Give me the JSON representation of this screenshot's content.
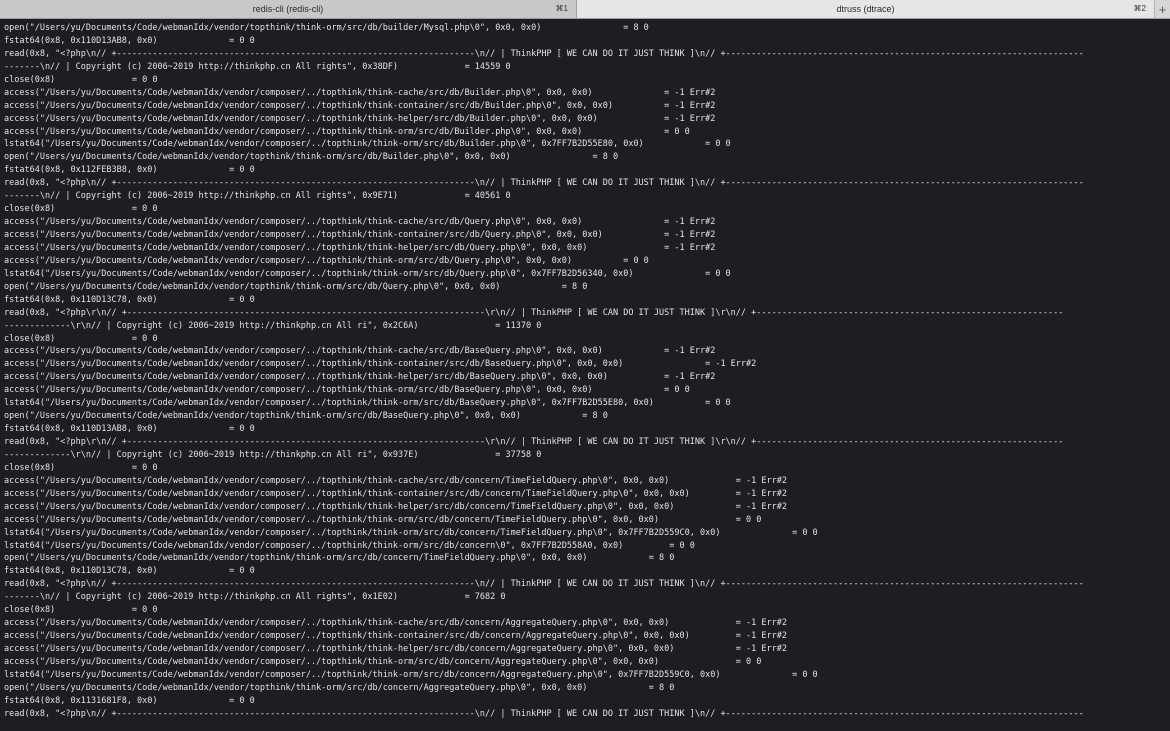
{
  "tabs": [
    {
      "label": "redis-cli (redis-cli)",
      "shortcut": "⌘1",
      "active": false
    },
    {
      "label": "dtruss (dtrace)",
      "shortcut": "⌘2",
      "active": true
    }
  ],
  "new_tab_icon": "+",
  "lines": [
    "open(\"/Users/yu/Documents/Code/webmanIdx/vendor/topthink/think-orm/src/db/builder/Mysql.php\\0\", 0x0, 0x0)                = 8 0",
    "fstat64(0x8, 0x110D13AB8, 0x0)              = 0 0",
    "read(0x8, \"<?php\\n// +----------------------------------------------------------------------\\n// | ThinkPHP [ WE CAN DO IT JUST THINK ]\\n// +----------------------------------------------------------------------",
    "-------\\n// | Copyright (c) 2006~2019 http://thinkphp.cn All rights\", 0x38DF)             = 14559 0",
    "close(0x8)               = 0 0",
    "access(\"/Users/yu/Documents/Code/webmanIdx/vendor/composer/../topthink/think-cache/src/db/Builder.php\\0\", 0x0, 0x0)              = -1 Err#2",
    "access(\"/Users/yu/Documents/Code/webmanIdx/vendor/composer/../topthink/think-container/src/db/Builder.php\\0\", 0x0, 0x0)          = -1 Err#2",
    "access(\"/Users/yu/Documents/Code/webmanIdx/vendor/composer/../topthink/think-helper/src/db/Builder.php\\0\", 0x0, 0x0)             = -1 Err#2",
    "access(\"/Users/yu/Documents/Code/webmanIdx/vendor/composer/../topthink/think-orm/src/db/Builder.php\\0\", 0x0, 0x0)                = 0 0",
    "lstat64(\"/Users/yu/Documents/Code/webmanIdx/vendor/composer/../topthink/think-orm/src/db/Builder.php\\0\", 0x7FF7B2D55E80, 0x0)            = 0 0",
    "open(\"/Users/yu/Documents/Code/webmanIdx/vendor/topthink/think-orm/src/db/Builder.php\\0\", 0x0, 0x0)                = 8 0",
    "fstat64(0x8, 0x112FEB3B8, 0x0)              = 0 0",
    "read(0x8, \"<?php\\n// +----------------------------------------------------------------------\\n// | ThinkPHP [ WE CAN DO IT JUST THINK ]\\n// +----------------------------------------------------------------------",
    "-------\\n// | Copyright (c) 2006~2019 http://thinkphp.cn All rights\", 0x9E71)             = 40561 0",
    "close(0x8)               = 0 0",
    "access(\"/Users/yu/Documents/Code/webmanIdx/vendor/composer/../topthink/think-cache/src/db/Query.php\\0\", 0x0, 0x0)                = -1 Err#2",
    "access(\"/Users/yu/Documents/Code/webmanIdx/vendor/composer/../topthink/think-container/src/db/Query.php\\0\", 0x0, 0x0)            = -1 Err#2",
    "access(\"/Users/yu/Documents/Code/webmanIdx/vendor/composer/../topthink/think-helper/src/db/Query.php\\0\", 0x0, 0x0)               = -1 Err#2",
    "access(\"/Users/yu/Documents/Code/webmanIdx/vendor/composer/../topthink/think-orm/src/db/Query.php\\0\", 0x0, 0x0)          = 0 0",
    "lstat64(\"/Users/yu/Documents/Code/webmanIdx/vendor/composer/../topthink/think-orm/src/db/Query.php\\0\", 0x7FF7B2D56340, 0x0)              = 0 0",
    "open(\"/Users/yu/Documents/Code/webmanIdx/vendor/topthink/think-orm/src/db/Query.php\\0\", 0x0, 0x0)            = 8 0",
    "fstat64(0x8, 0x110D13C78, 0x0)              = 0 0",
    "read(0x8, \"<?php\\r\\n// +----------------------------------------------------------------------\\r\\n// | ThinkPHP [ WE CAN DO IT JUST THINK ]\\r\\n// +------------------------------------------------------------",
    "-------------\\r\\n// | Copyright (c) 2006~2019 http://thinkphp.cn All ri\", 0x2C6A)               = 11370 0",
    "close(0x8)               = 0 0",
    "access(\"/Users/yu/Documents/Code/webmanIdx/vendor/composer/../topthink/think-cache/src/db/BaseQuery.php\\0\", 0x0, 0x0)            = -1 Err#2",
    "access(\"/Users/yu/Documents/Code/webmanIdx/vendor/composer/../topthink/think-container/src/db/BaseQuery.php\\0\", 0x0, 0x0)                = -1 Err#2",
    "access(\"/Users/yu/Documents/Code/webmanIdx/vendor/composer/../topthink/think-helper/src/db/BaseQuery.php\\0\", 0x0, 0x0)           = -1 Err#2",
    "access(\"/Users/yu/Documents/Code/webmanIdx/vendor/composer/../topthink/think-orm/src/db/BaseQuery.php\\0\", 0x0, 0x0)              = 0 0",
    "lstat64(\"/Users/yu/Documents/Code/webmanIdx/vendor/composer/../topthink/think-orm/src/db/BaseQuery.php\\0\", 0x7FF7B2D55E80, 0x0)          = 0 0",
    "open(\"/Users/yu/Documents/Code/webmanIdx/vendor/topthink/think-orm/src/db/BaseQuery.php\\0\", 0x0, 0x0)            = 8 0",
    "fstat64(0x8, 0x110D13AB8, 0x0)              = 0 0",
    "read(0x8, \"<?php\\r\\n// +----------------------------------------------------------------------\\r\\n// | ThinkPHP [ WE CAN DO IT JUST THINK ]\\r\\n// +------------------------------------------------------------",
    "-------------\\r\\n// | Copyright (c) 2006~2019 http://thinkphp.cn All ri\", 0x937E)               = 37758 0",
    "close(0x8)               = 0 0",
    "access(\"/Users/yu/Documents/Code/webmanIdx/vendor/composer/../topthink/think-cache/src/db/concern/TimeFieldQuery.php\\0\", 0x0, 0x0)             = -1 Err#2",
    "access(\"/Users/yu/Documents/Code/webmanIdx/vendor/composer/../topthink/think-container/src/db/concern/TimeFieldQuery.php\\0\", 0x0, 0x0)         = -1 Err#2",
    "access(\"/Users/yu/Documents/Code/webmanIdx/vendor/composer/../topthink/think-helper/src/db/concern/TimeFieldQuery.php\\0\", 0x0, 0x0)            = -1 Err#2",
    "access(\"/Users/yu/Documents/Code/webmanIdx/vendor/composer/../topthink/think-orm/src/db/concern/TimeFieldQuery.php\\0\", 0x0, 0x0)               = 0 0",
    "lstat64(\"/Users/yu/Documents/Code/webmanIdx/vendor/composer/../topthink/think-orm/src/db/concern/TimeFieldQuery.php\\0\", 0x7FF7B2D559C0, 0x0)              = 0 0",
    "lstat64(\"/Users/yu/Documents/Code/webmanIdx/vendor/composer/../topthink/think-orm/src/db/concern\\0\", 0x7FF7B2D558A0, 0x0)         = 0 0",
    "open(\"/Users/yu/Documents/Code/webmanIdx/vendor/topthink/think-orm/src/db/concern/TimeFieldQuery.php\\0\", 0x0, 0x0)            = 8 0",
    "fstat64(0x8, 0x110D13C78, 0x0)              = 0 0",
    "read(0x8, \"<?php\\n// +----------------------------------------------------------------------\\n// | ThinkPHP [ WE CAN DO IT JUST THINK ]\\n// +----------------------------------------------------------------------",
    "-------\\n// | Copyright (c) 2006~2019 http://thinkphp.cn All rights\", 0x1E02)             = 7682 0",
    "close(0x8)               = 0 0",
    "access(\"/Users/yu/Documents/Code/webmanIdx/vendor/composer/../topthink/think-cache/src/db/concern/AggregateQuery.php\\0\", 0x0, 0x0)             = -1 Err#2",
    "access(\"/Users/yu/Documents/Code/webmanIdx/vendor/composer/../topthink/think-container/src/db/concern/AggregateQuery.php\\0\", 0x0, 0x0)         = -1 Err#2",
    "access(\"/Users/yu/Documents/Code/webmanIdx/vendor/composer/../topthink/think-helper/src/db/concern/AggregateQuery.php\\0\", 0x0, 0x0)            = -1 Err#2",
    "access(\"/Users/yu/Documents/Code/webmanIdx/vendor/composer/../topthink/think-orm/src/db/concern/AggregateQuery.php\\0\", 0x0, 0x0)               = 0 0",
    "lstat64(\"/Users/yu/Documents/Code/webmanIdx/vendor/composer/../topthink/think-orm/src/db/concern/AggregateQuery.php\\0\", 0x7FF7B2D559C0, 0x0)              = 0 0",
    "open(\"/Users/yu/Documents/Code/webmanIdx/vendor/topthink/think-orm/src/db/concern/AggregateQuery.php\\0\", 0x0, 0x0)            = 8 0",
    "fstat64(0x8, 0x1131681F8, 0x0)              = 0 0",
    "read(0x8, \"<?php\\n// +----------------------------------------------------------------------\\n// | ThinkPHP [ WE CAN DO IT JUST THINK ]\\n// +----------------------------------------------------------------------"
  ]
}
